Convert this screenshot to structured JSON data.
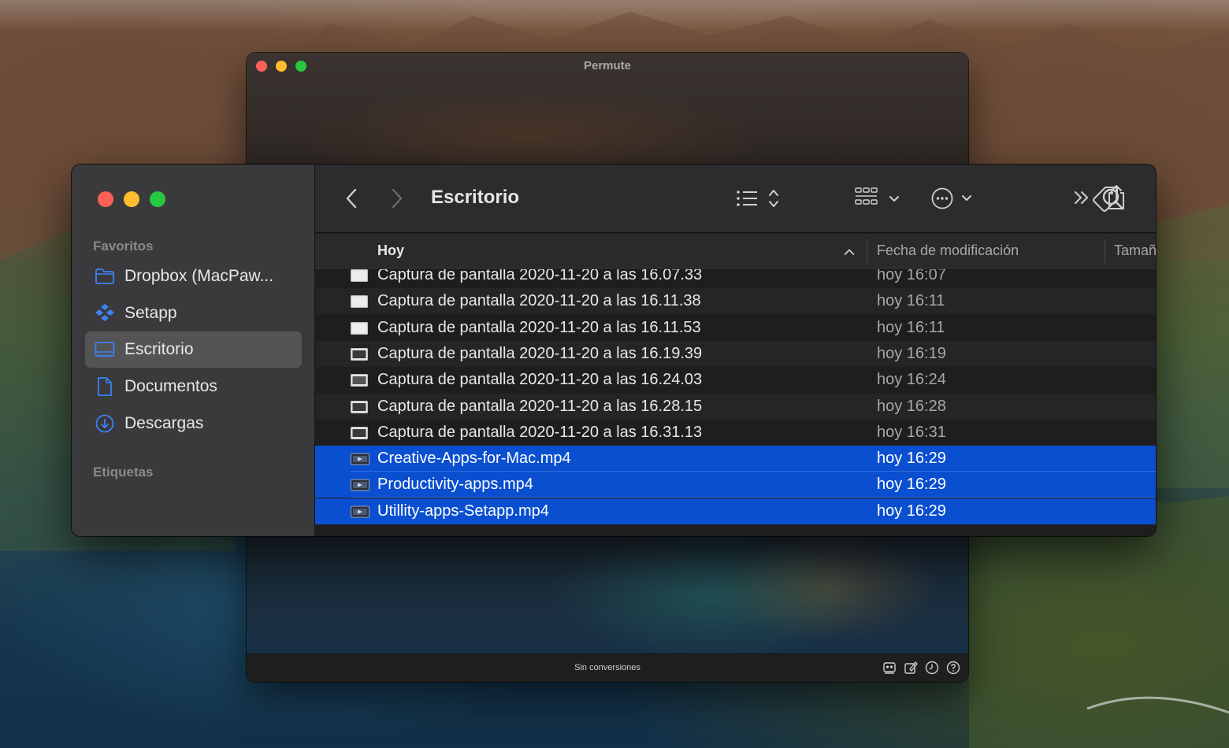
{
  "permute": {
    "title": "Permute",
    "status": "Sin conversiones"
  },
  "finder": {
    "sidebar": {
      "favorites_title": "Favoritos",
      "tags_title": "Etiquetas",
      "items": [
        {
          "label": "Dropbox (MacPaw...",
          "icon": "folder-icon"
        },
        {
          "label": "Setapp",
          "icon": "setapp-icon"
        },
        {
          "label": "Escritorio",
          "icon": "desktop-icon",
          "active": true
        },
        {
          "label": "Documentos",
          "icon": "document-icon"
        },
        {
          "label": "Descargas",
          "icon": "download-icon"
        }
      ]
    },
    "toolbar": {
      "title": "Escritorio"
    },
    "columns": {
      "name": "Hoy",
      "date": "Fecha de modificación",
      "size": "Tamaño"
    },
    "files": [
      {
        "name": "Captura de pantalla 2020-11-20 a las 16.07.33",
        "date": "hoy 16:07",
        "selected": false
      },
      {
        "name": "Captura de pantalla 2020-11-20 a las 16.11.38",
        "date": "hoy 16:11",
        "selected": false
      },
      {
        "name": "Captura de pantalla 2020-11-20 a las 16.11.53",
        "date": "hoy 16:11",
        "selected": false
      },
      {
        "name": "Captura de pantalla 2020-11-20 a las 16.19.39",
        "date": "hoy 16:19",
        "selected": false
      },
      {
        "name": "Captura de pantalla 2020-11-20 a las 16.24.03",
        "date": "hoy 16:24",
        "selected": false
      },
      {
        "name": "Captura de pantalla 2020-11-20 a las 16.28.15",
        "date": "hoy 16:28",
        "selected": false
      },
      {
        "name": "Captura de pantalla 2020-11-20 a las 16.31.13",
        "date": "hoy 16:31",
        "selected": false
      },
      {
        "name": "Creative-Apps-for-Mac.mp4",
        "date": "hoy 16:29",
        "selected": true
      },
      {
        "name": "Productivity-apps.mp4",
        "date": "hoy 16:29",
        "selected": true
      },
      {
        "name": "Utillity-apps-Setapp.mp4",
        "date": "hoy 16:29",
        "selected": true
      }
    ],
    "colors": {
      "selection": "#0a4fd0",
      "accent_icon": "#3b82f6"
    }
  }
}
